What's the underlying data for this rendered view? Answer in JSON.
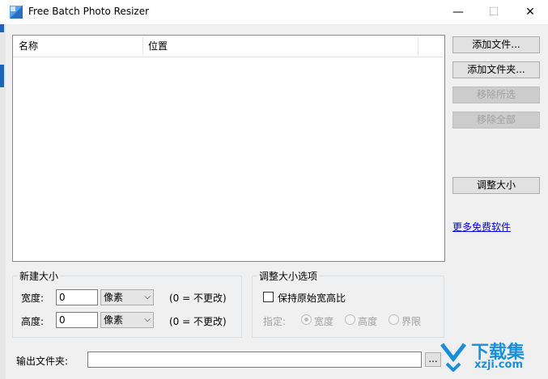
{
  "window": {
    "title": "Free Batch Photo Resizer",
    "minimize_glyph": "—",
    "maximize_glyph": "☐",
    "close_glyph": "✕"
  },
  "file_list": {
    "columns": [
      "名称",
      "位置"
    ],
    "rows": []
  },
  "buttons": {
    "add_file": "添加文件...",
    "add_folder": "添加文件夹...",
    "remove_selected": "移除所选",
    "remove_all": "移除全部",
    "resize": "调整大小"
  },
  "more_free_software_link": "更多免费软件",
  "new_size": {
    "title": "新建大小",
    "width_label": "宽度:",
    "width_value": "0",
    "width_unit": "像素",
    "width_hint": "(0 = 不更改)",
    "height_label": "高度:",
    "height_value": "0",
    "height_unit": "像素",
    "height_hint": "(0 = 不更改)"
  },
  "resize_options": {
    "title": "调整大小选项",
    "keep_aspect_label": "保持原始宽高比",
    "keep_aspect_checked": false,
    "specify_label": "指定:",
    "options": [
      "宽度",
      "高度",
      "界限"
    ],
    "selected": "宽度"
  },
  "output": {
    "label": "输出文件夹:",
    "value": "",
    "browse_label": "..."
  },
  "watermark": {
    "text": "下载集",
    "url": "xzji.com"
  },
  "colors": {
    "accent_link": "#0000ee",
    "watermark_blue": "#1a8fd9"
  }
}
